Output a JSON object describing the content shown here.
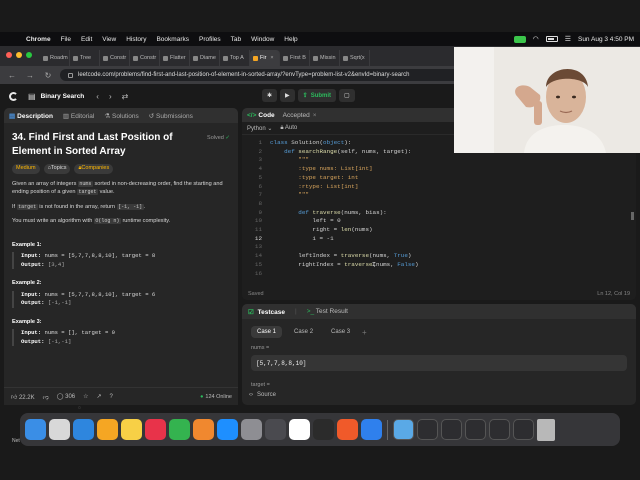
{
  "menubar": {
    "app": "Chrome",
    "items": [
      "File",
      "Edit",
      "View",
      "History",
      "Bookmarks",
      "Profiles",
      "Tab",
      "Window",
      "Help"
    ],
    "datetime": "Sun Aug 3  4:50 PM"
  },
  "browser": {
    "tabs": [
      "Roadm",
      "Tree",
      "Constr",
      "Constr",
      "Flatter",
      "Diame",
      "Top A",
      "Fir",
      "First B",
      "Missin",
      "Sqrt(x"
    ],
    "active_tab_index": 7,
    "url": "leetcode.com/problems/find-first-and-last-position-of-element-in-sorted-array/?envType=problem-list-v2&envId=binary-search"
  },
  "header": {
    "list_title": "Binary Search",
    "submit_label": "Submit"
  },
  "left_tabs": [
    "Description",
    "Editorial",
    "Solutions",
    "Submissions"
  ],
  "problem": {
    "title": "34. Find First and Last Position of Element in Sorted Array",
    "status": "Solved",
    "difficulty": "Medium",
    "topics_label": "Topics",
    "companies_label": "Companies",
    "p1_a": "Given an array of integers ",
    "p1_code1": "nums",
    "p1_b": " sorted in non-decreasing order, find the starting and ending position of a given ",
    "p1_code2": "target",
    "p1_c": " value.",
    "p2_a": "If ",
    "p2_code1": "target",
    "p2_b": " is not found in the array, return ",
    "p2_code2": "[-1, -1]",
    "p2_c": ".",
    "p3_a": "You must write an algorithm with ",
    "p3_code": "O(log n)",
    "p3_b": " runtime complexity.",
    "examples": [
      {
        "title": "Example 1:",
        "input_label": "Input:",
        "input": "nums = [5,7,7,8,8,10], target = 8",
        "output_label": "Output:",
        "output": "[3,4]"
      },
      {
        "title": "Example 2:",
        "input_label": "Input:",
        "input": "nums = [5,7,7,8,8,10], target = 6",
        "output_label": "Output:",
        "output": "[-1,-1]"
      },
      {
        "title": "Example 3:",
        "input_label": "Input:",
        "input": "nums = [], target = 0",
        "output_label": "Output:",
        "output": "[-1,-1]"
      }
    ]
  },
  "footer": {
    "likes": "22.2K",
    "comments": "306",
    "online": "124 Online"
  },
  "code_panel": {
    "tab_code": "Code",
    "tab_accepted": "Accepted",
    "language": "Python",
    "mode": "Auto",
    "saved": "Saved",
    "position": "Ln 12, Col 19",
    "lines": [
      {
        "n": "1",
        "t": "class Solution(object):"
      },
      {
        "n": "2",
        "t": "    def searchRange(self, nums, target):"
      },
      {
        "n": "3",
        "t": "        \"\"\""
      },
      {
        "n": "4",
        "t": "        :type nums: List[int]"
      },
      {
        "n": "5",
        "t": "        :type target: int"
      },
      {
        "n": "6",
        "t": "        :rtype: List[int]"
      },
      {
        "n": "7",
        "t": "        \"\"\""
      },
      {
        "n": "8",
        "t": ""
      },
      {
        "n": "9",
        "t": "        def traverse(nums, bias):"
      },
      {
        "n": "10",
        "t": "            left = 0"
      },
      {
        "n": "11",
        "t": "            right = len(nums)"
      },
      {
        "n": "12",
        "t": "            i = -1"
      },
      {
        "n": "13",
        "t": ""
      },
      {
        "n": "14",
        "t": "        leftIndex = traverse(nums, True)"
      },
      {
        "n": "15",
        "t": "        rightIndex = traverse(nums, False)"
      },
      {
        "n": "16",
        "t": ""
      }
    ]
  },
  "testcase": {
    "tab_testcase": "Testcase",
    "tab_result": "Test Result",
    "cases": [
      "Case 1",
      "Case 2",
      "Case 3"
    ],
    "nums_label": "nums =",
    "nums_value": "[5,7,7,8,8,10]",
    "target_label": "target =",
    "source_label": "Source"
  },
  "dock": {
    "apps": [
      "finder",
      "launchpad",
      "safari",
      "photos",
      "notes",
      "news",
      "numbers",
      "pages",
      "app-store",
      "settings",
      "quicktime",
      "chrome",
      "terminal",
      "brave",
      "vscode"
    ],
    "colors": [
      "#3a8ee6",
      "#d8d8d8",
      "#2e86de",
      "#f5a623",
      "#f7d046",
      "#e8334a",
      "#34b34f",
      "#f0882f",
      "#1e8fff",
      "#8e8e93",
      "#4a4a4f",
      "#ffffff",
      "#2b2b2b",
      "#f05a2a",
      "#2f80ed"
    ],
    "label": "Net"
  }
}
